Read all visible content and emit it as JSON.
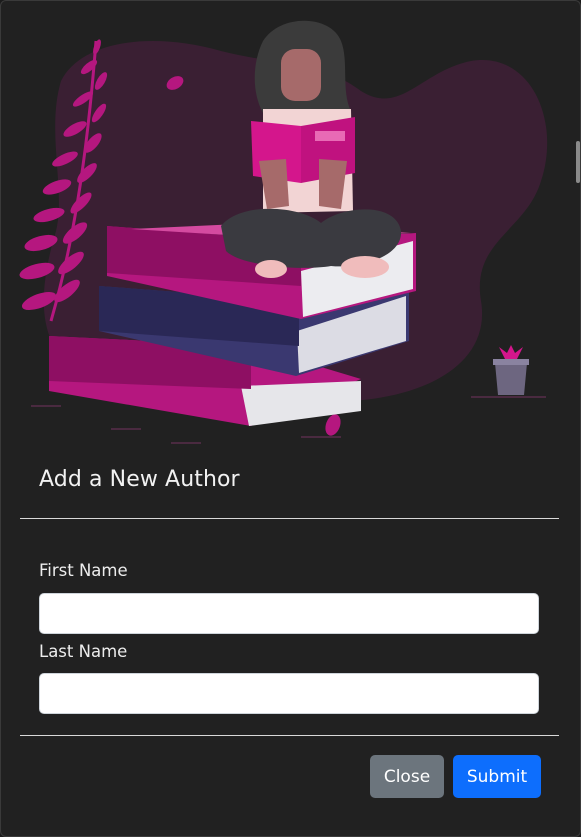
{
  "modal": {
    "title": "Add a New Author",
    "fields": [
      {
        "label": "First Name",
        "value": "",
        "placeholder": ""
      },
      {
        "label": "Last Name",
        "value": "",
        "placeholder": ""
      }
    ],
    "buttons": {
      "close_label": "Close",
      "submit_label": "Submit"
    }
  },
  "illustration": {
    "icon": "woman-reading-on-books-illustration",
    "colors": {
      "accent": "#b5177f",
      "blob": "#3a1f33",
      "book_blue": "#3a3870",
      "background": "#212121"
    }
  },
  "colors": {
    "primary_button": "#0d6efd",
    "secondary_button": "#6c757d"
  }
}
